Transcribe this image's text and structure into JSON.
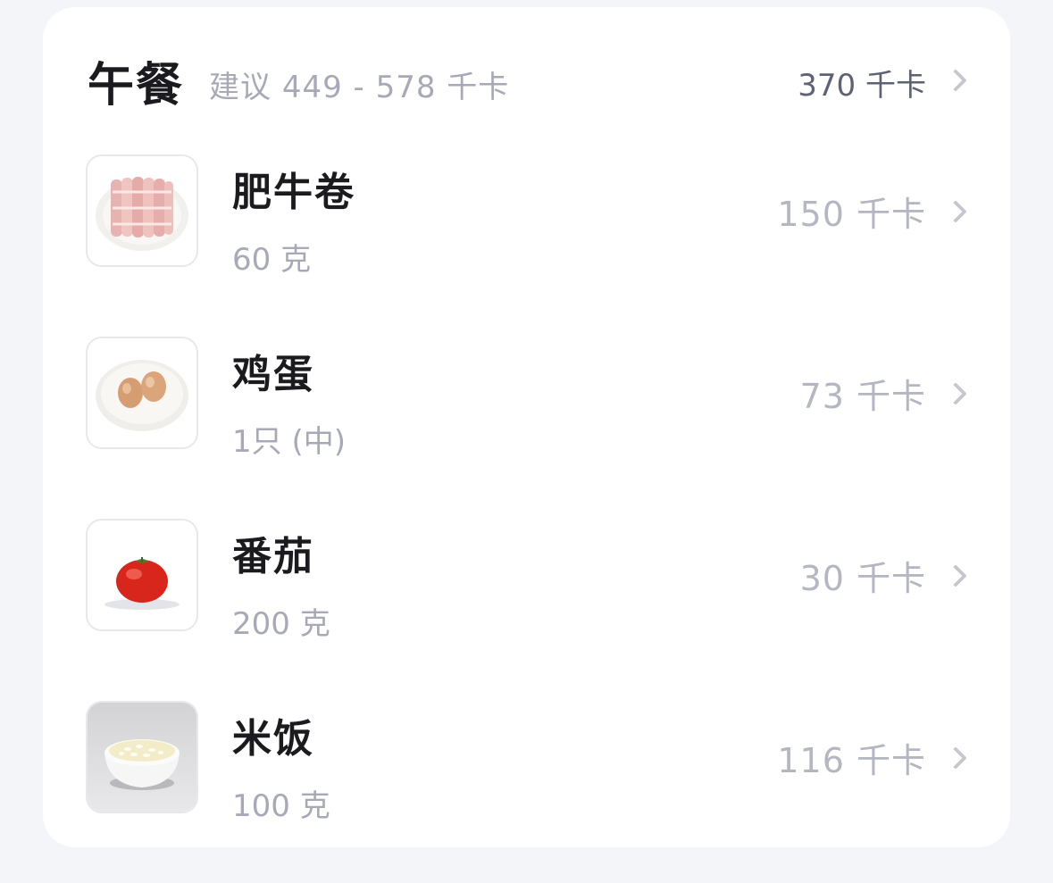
{
  "meal": {
    "title": "午餐",
    "suggestion": "建议 449 - 578 千卡",
    "total": "370 千卡"
  },
  "foods": [
    {
      "name": "肥牛卷",
      "amount": "60 克",
      "calories": "150 千卡",
      "image": "beef-rolls"
    },
    {
      "name": "鸡蛋",
      "amount": "1只 (中)",
      "calories": "73 千卡",
      "image": "eggs"
    },
    {
      "name": "番茄",
      "amount": "200 克",
      "calories": "30 千卡",
      "image": "tomato"
    },
    {
      "name": "米饭",
      "amount": "100 克",
      "calories": "116 千卡",
      "image": "rice-bowl"
    }
  ],
  "colors": {
    "background": "#f4f5f9",
    "card": "#ffffff",
    "primary_text": "#1b1b1f",
    "secondary_text": "#a8a9b6",
    "total_text": "#5d6274"
  }
}
